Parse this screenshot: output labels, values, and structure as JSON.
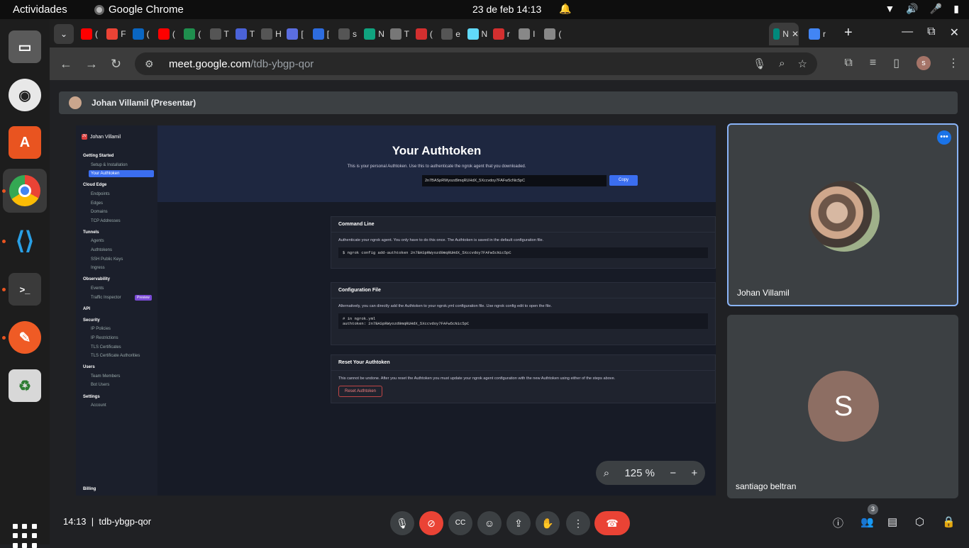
{
  "topbar": {
    "activities": "Actividades",
    "app_name": "Google Chrome",
    "clock": "23 de feb  14:13"
  },
  "tabs": [
    {
      "icon": "youtube",
      "label": "(",
      "color": "#ff0000"
    },
    {
      "icon": "gmail",
      "label": "F",
      "color": "#ea4335"
    },
    {
      "icon": "linkedin",
      "label": "(",
      "color": "#0a66c2"
    },
    {
      "icon": "youtube",
      "label": "(",
      "color": "#ff0000"
    },
    {
      "icon": "w-logo",
      "label": "(",
      "color": "#1f8f4e"
    },
    {
      "icon": "github",
      "label": "T",
      "color": "#555555"
    },
    {
      "icon": "app",
      "label": "T",
      "color": "#4a62d8"
    },
    {
      "icon": "github",
      "label": "H",
      "color": "#555555"
    },
    {
      "icon": "app",
      "label": "[",
      "color": "#5b6ee1"
    },
    {
      "icon": "app",
      "label": "[",
      "color": "#2d6cdf"
    },
    {
      "icon": "github",
      "label": "s",
      "color": "#555555"
    },
    {
      "icon": "chatgpt",
      "label": "N",
      "color": "#10a37f"
    },
    {
      "icon": "app",
      "label": "T",
      "color": "#777777"
    },
    {
      "icon": "app",
      "label": "(",
      "color": "#d32f2f"
    },
    {
      "icon": "github",
      "label": "e",
      "color": "#555555"
    },
    {
      "icon": "react",
      "label": "N",
      "color": "#61dafb"
    },
    {
      "icon": "app",
      "label": "r",
      "color": "#d32f2f"
    },
    {
      "icon": "app",
      "label": "I",
      "color": "#888888"
    },
    {
      "icon": "app",
      "label": "(",
      "color": "#888888"
    },
    {
      "icon": "meet",
      "label": "N",
      "color": "#00897b"
    },
    {
      "icon": "google",
      "label": "r",
      "color": "#4285f4"
    }
  ],
  "omnibox": {
    "host": "meet.google.com",
    "path": "/tdb-ybgp-qor"
  },
  "presenter_bar": {
    "label": "Johan Villamil (Presentar)"
  },
  "shared": {
    "user": "Johan Villamil",
    "sidebar": [
      {
        "group": "Getting Started",
        "items": [
          "Setup & Installation",
          "Your Authtoken"
        ]
      },
      {
        "group": "Cloud Edge",
        "items": [
          "Endpoints",
          "Edges",
          "Domains",
          "TCP Addresses"
        ]
      },
      {
        "group": "Tunnels",
        "items": [
          "Agents",
          "Authtokens",
          "SSH Public Keys",
          "Ingress"
        ]
      },
      {
        "group": "Observability",
        "items": [
          "Events",
          "Traffic Inspector"
        ]
      },
      {
        "group": "API",
        "items": []
      },
      {
        "group": "Security",
        "items": [
          "IP Policies",
          "IP Restrictions",
          "TLS Certificates",
          "TLS Certificate Authorities"
        ]
      },
      {
        "group": "Users",
        "items": [
          "Team Members",
          "Bot Users"
        ]
      },
      {
        "group": "Settings",
        "items": [
          "Account"
        ]
      }
    ],
    "preview_badge": "Preview",
    "billing": "Billing",
    "title": "Your Authtoken",
    "subtitle": "This is your personal Authtoken. Use this to authenticate the ngrok agent that you downloaded.",
    "token": "2n7BASpRWyozd9mqRUHdX_5Xccvdoy7FAFw5cNic5pC",
    "copy": "Copy",
    "cmd_title": "Command Line",
    "cmd_desc": "Authenticate your ngrok agent. You only have to do this once. The Authtoken is saved in the default configuration file.",
    "cmd_code": "$ ngrok config add-authtoken 2n7BASpRWyozd9mqRUHdX_5Xccvdoy7FAFw5cNic5pC",
    "cfg_title": "Configuration File",
    "cfg_desc": "Alternatively, you can directly add the Authtoken to your ngrok.yml configuration file. Use ngrok config edit to open the file.",
    "cfg_code": "# in ngrok.yml\nauthtoken: 2n7BASpRWyozd9mqRUHdX_5Xccvdoy7FAFw5cNic5pC",
    "reset_title": "Reset Your Authtoken",
    "reset_desc": "This cannot be undone. After you reset the Authtoken you must update your ngrok agent configuration with the new Authtoken using either of the steps above.",
    "reset_btn": "Reset Authtoken"
  },
  "zoom": {
    "value": "125 %"
  },
  "participants": [
    {
      "name": "Johan Villamil"
    },
    {
      "name": "santiago beltran",
      "initial": "S"
    }
  ],
  "bottom": {
    "time": "14:13",
    "sep": "|",
    "code": "tdb-ybgp-qor",
    "people_count": "3"
  }
}
